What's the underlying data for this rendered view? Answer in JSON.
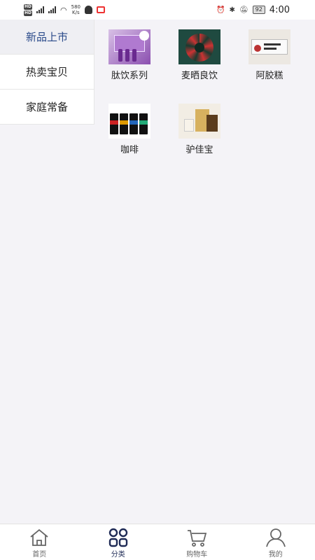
{
  "status_bar": {
    "network_speed": "580",
    "network_unit": "K/s",
    "battery": "92",
    "time": "4:00"
  },
  "sidebar": {
    "items": [
      {
        "label": "新品上市",
        "active": true
      },
      {
        "label": "热卖宝贝",
        "active": false
      },
      {
        "label": "家庭常备",
        "active": false
      }
    ]
  },
  "products": [
    {
      "label": "肽饮系列",
      "icon": "peptide-drink-image"
    },
    {
      "label": "麦晒良饮",
      "icon": "wheat-drink-image"
    },
    {
      "label": "阿胶糕",
      "icon": "ejiao-cake-image"
    },
    {
      "label": "咖啡",
      "icon": "coffee-image"
    },
    {
      "label": "驴佳宝",
      "icon": "lv-jia-bao-image"
    }
  ],
  "tabbar": {
    "items": [
      {
        "label": "首页",
        "icon": "home-icon",
        "active": false
      },
      {
        "label": "分类",
        "icon": "category-grid-icon",
        "active": true
      },
      {
        "label": "购物车",
        "icon": "cart-icon",
        "active": false
      },
      {
        "label": "我的",
        "icon": "user-icon",
        "active": false
      }
    ]
  },
  "colors": {
    "active_blue": "#1e2a55",
    "background": "#f4f3f7"
  }
}
